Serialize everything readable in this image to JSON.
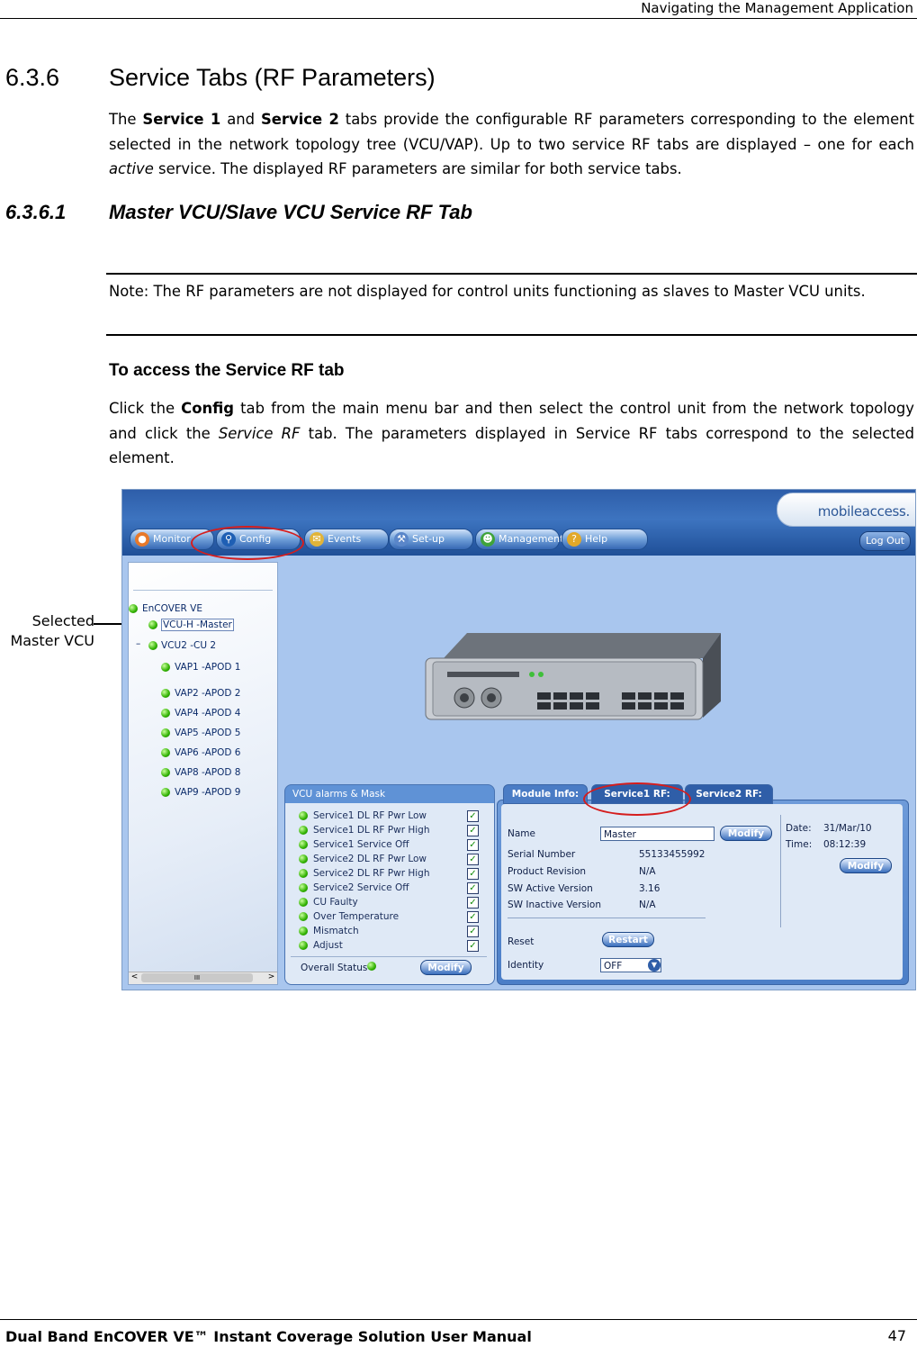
{
  "header": {
    "text": "Navigating the Management Application"
  },
  "section": {
    "number": "6.3.6",
    "title": "Service Tabs (RF Parameters)",
    "intro": {
      "t1": "The ",
      "b1": "Service 1",
      "t2": " and ",
      "b2": "Service 2",
      "t3": " tabs provide the configurable RF parameters corresponding to the element selected in the network topology tree (VCU/VAP). Up to two service RF tabs are displayed – one for each ",
      "i1": "active",
      "t4": " service. The displayed RF parameters are similar for both service tabs."
    }
  },
  "subsection": {
    "number": "6.3.6.1",
    "title": "Master VCU/Slave VCU Service RF Tab"
  },
  "note": "Note: The RF parameters are not displayed for control units functioning as slaves to Master VCU units.",
  "procedure": {
    "heading": "To access the Service RF tab",
    "t1": "Click the ",
    "b1": "Config",
    "t2": " tab from the main menu bar and then select the control unit from the network topology and click the ",
    "i1": "Service RF",
    "t3": " tab. The parameters displayed in Service RF tabs correspond to the selected element."
  },
  "callout": {
    "line1": "Selected",
    "line2": "Master VCU"
  },
  "app": {
    "logo": "mobileaccess.",
    "menu": [
      {
        "label": "Monitor",
        "icon": "globe-icon"
      },
      {
        "label": "Config",
        "icon": "wrench-icon"
      },
      {
        "label": "Events",
        "icon": "bell-icon"
      },
      {
        "label": "Set-up",
        "icon": "tools-icon"
      },
      {
        "label": "Management",
        "icon": "people-icon"
      },
      {
        "label": "Help",
        "icon": "help-icon"
      }
    ],
    "logout": "Log Out",
    "tree": {
      "root": "EnCOVER VE",
      "selected": "VCU-H -Master",
      "collapse": "–",
      "slave": "VCU2 -CU 2",
      "vaps": [
        "VAP1 -APOD 1",
        "VAP2 -APOD 2",
        "VAP4 -APOD 4",
        "VAP5 -APOD 5",
        "VAP6 -APOD 6",
        "VAP8 -APOD 8",
        "VAP9 -APOD 9"
      ],
      "scroll_left": "<",
      "scroll_mid": "III",
      "scroll_right": ">"
    },
    "alarms": {
      "title": "VCU alarms & Mask",
      "items": [
        "Service1 DL RF Pwr Low",
        "Service1 DL RF Pwr High",
        "Service1 Service Off",
        "Service2 DL RF Pwr Low",
        "Service2 DL RF Pwr High",
        "Service2 Service Off",
        "CU Faulty",
        "Over Temperature",
        "Mismatch",
        "Adjust"
      ],
      "check": "✓",
      "overall_label": "Overall Status",
      "modify": "Modify"
    },
    "tabs": {
      "module": "Module Info:",
      "service1": "Service1 RF:",
      "service2": "Service2 RF:"
    },
    "module_info": {
      "name_label": "Name",
      "name_value": "Master",
      "modify": "Modify",
      "date_label": "Date:",
      "date_value": "31/Mar/10",
      "time_label": "Time:",
      "time_value": "08:12:39",
      "modify2": "Modify",
      "serial_label": "Serial Number",
      "serial_value": "55133455992",
      "revision_label": "Product Revision",
      "revision_value": "N/A",
      "sw_active_label": "SW Active Version",
      "sw_active_value": "3.16",
      "sw_inactive_label": "SW Inactive Version",
      "sw_inactive_value": "N/A",
      "reset_label": "Reset",
      "restart": "Restart",
      "identity_label": "Identity",
      "identity_value": "OFF"
    }
  },
  "footer": {
    "title": "Dual Band EnCOVER VE™ Instant Coverage Solution User Manual",
    "page": "47"
  }
}
